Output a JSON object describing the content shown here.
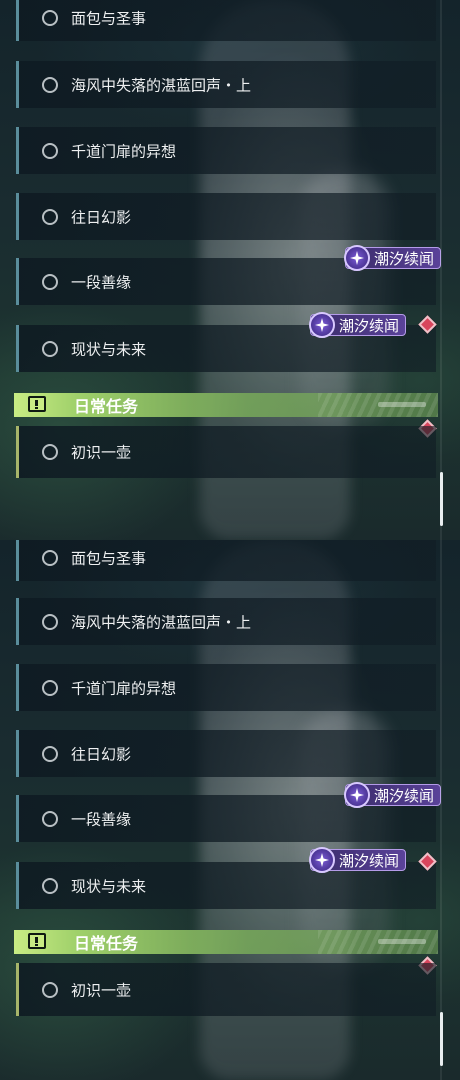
{
  "quests": [
    {
      "label": "面包与圣事"
    },
    {
      "label": "海风中失落的湛蓝回声・上"
    },
    {
      "label": "千道门扉的异想"
    },
    {
      "label": "往日幻影"
    },
    {
      "label": "一段善缘"
    },
    {
      "label": "现状与未来"
    }
  ],
  "daily_section": {
    "title": "日常任务"
  },
  "daily_quests": [
    {
      "label": "初识一壶"
    }
  ],
  "tide_badge": {
    "label": "潮汐续闻"
  },
  "icons": {
    "quest_status": "circle-icon",
    "daily_header": "exclamation-box-icon",
    "tide": "tide-sparkle-icon",
    "alert": "red-diamond-icon"
  },
  "colors": {
    "accent_green": "#c9ec84",
    "row_border": "#5a8d9b",
    "badge_purple": "#5a4299",
    "alert_red": "#d8455c"
  }
}
